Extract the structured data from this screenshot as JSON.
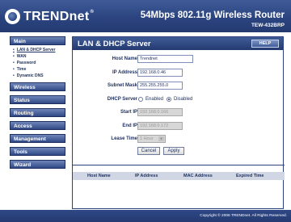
{
  "header": {
    "brand": "TRENDnet",
    "product_title": "54Mbps 802.11g Wireless Router",
    "model": "TEW-432BRP"
  },
  "sidebar": {
    "main_label": "Main",
    "subitems": [
      {
        "label": "LAN & DHCP Server",
        "active": true
      },
      {
        "label": "WAN",
        "active": false
      },
      {
        "label": "Password",
        "active": false
      },
      {
        "label": "Time",
        "active": false
      },
      {
        "label": "Dynamic DNS",
        "active": false
      }
    ],
    "sections": [
      "Wireless",
      "Status",
      "Routing",
      "Access",
      "Management",
      "Tools",
      "Wizard"
    ]
  },
  "panel": {
    "title": "LAN & DHCP Server",
    "help_label": "HELP",
    "fields": {
      "host_name": {
        "label": "Host Name",
        "value": "Trendnet"
      },
      "ip_address": {
        "label": "IP Address",
        "value": "192.168.0.46"
      },
      "subnet_mask": {
        "label": "Subnet Mask",
        "value": "255.255.255.0"
      },
      "dhcp_server": {
        "label": "DHCP Server",
        "option_enabled": "Enabled",
        "option_disabled": "Disabled",
        "selected": "Disabled"
      },
      "start_ip": {
        "label": "Start IP",
        "value": "192.168.0.166"
      },
      "end_ip": {
        "label": "End IP",
        "value": "192.168.0.172"
      },
      "lease_time": {
        "label": "Lease Time",
        "value": "1 Hour"
      }
    },
    "cancel_label": "Cancel",
    "apply_label": "Apply",
    "table_headers": [
      "Host Name",
      "IP Address",
      "MAC Address",
      "Expired Time"
    ]
  },
  "footer": {
    "copyright": "Copyright © 2006 TRENDnet. All Rights Reserved."
  }
}
